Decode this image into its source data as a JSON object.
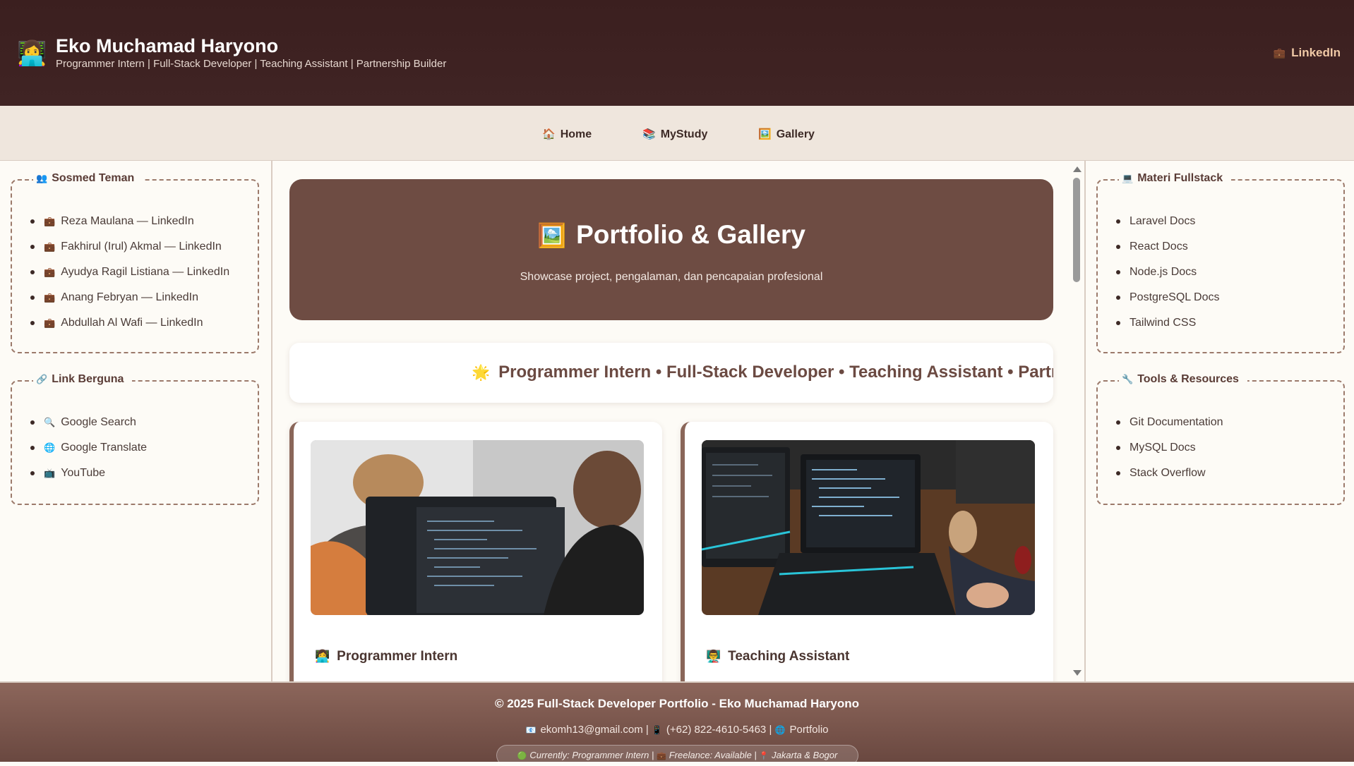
{
  "header": {
    "icon": "👩‍💻",
    "name": "Eko Muchamad Haryono",
    "tagline": "Programmer Intern | Full-Stack Developer | Teaching Assistant | Partnership Builder",
    "link_icon": "💼",
    "link_label": "LinkedIn"
  },
  "nav": {
    "items": [
      {
        "icon": "🏠",
        "label": "Home"
      },
      {
        "icon": "📚",
        "label": "MyStudy"
      },
      {
        "icon": "🖼️",
        "label": "Gallery"
      }
    ]
  },
  "left_sidebar": {
    "friends": {
      "icon": "👥",
      "title": "Sosmed Teman",
      "items": [
        {
          "icon": "💼",
          "label": "Reza Maulana — LinkedIn"
        },
        {
          "icon": "💼",
          "label": "Fakhirul (Irul) Akmal — LinkedIn"
        },
        {
          "icon": "💼",
          "label": "Ayudya Ragil Listiana — LinkedIn"
        },
        {
          "icon": "💼",
          "label": "Anang Febryan — LinkedIn"
        },
        {
          "icon": "💼",
          "label": "Abdullah Al Wafi — LinkedIn"
        }
      ]
    },
    "links": {
      "icon": "🔗",
      "title": "Link Berguna",
      "items": [
        {
          "icon": "🔍",
          "label": "Google Search"
        },
        {
          "icon": "🌐",
          "label": "Google Translate"
        },
        {
          "icon": "📺",
          "label": "YouTube"
        }
      ]
    }
  },
  "right_sidebar": {
    "materi": {
      "icon": "💻",
      "title": "Materi Fullstack",
      "items": [
        "Laravel Docs",
        "React Docs",
        "Node.js Docs",
        "PostgreSQL Docs",
        "Tailwind CSS"
      ]
    },
    "tools": {
      "icon": "🔧",
      "title": "Tools & Resources",
      "items": [
        "Git Documentation",
        "MySQL Docs",
        "Stack Overflow"
      ]
    }
  },
  "main": {
    "hero": {
      "icon": "🖼️",
      "title": "Portfolio & Gallery",
      "subtitle": "Showcase project, pengalaman, dan pencapaian profesional"
    },
    "marquee": {
      "icon": "🌟",
      "text": "Programmer Intern • Full-Stack Developer • Teaching Assistant • Partnersh"
    },
    "cards": [
      {
        "icon": "👩‍💻",
        "title": "Programmer Intern"
      },
      {
        "icon": "👨‍🏫",
        "title": "Teaching Assistant"
      }
    ]
  },
  "footer": {
    "copyright": "© 2025 Full-Stack Developer Portfolio - Eko Muchamad Haryono",
    "email_icon": "📧",
    "email": "ekomh13@gmail.com",
    "phone_icon": "📱",
    "phone": "(+62) 822-4610-5463",
    "portfolio_icon": "🌐",
    "portfolio": "Portfolio",
    "status_icon": "🟢",
    "status": "Currently: Programmer Intern",
    "freelance_icon": "💼",
    "freelance": "Freelance: Available",
    "location_icon": "📍",
    "location": "Jakarta & Bogor"
  },
  "colors": {
    "header_bg": "#3b1f1f",
    "hero_bg": "#6e4c43",
    "nav_bg": "#efe6dd",
    "accent": "#8a6659",
    "link_accent": "#f0c9a6"
  }
}
